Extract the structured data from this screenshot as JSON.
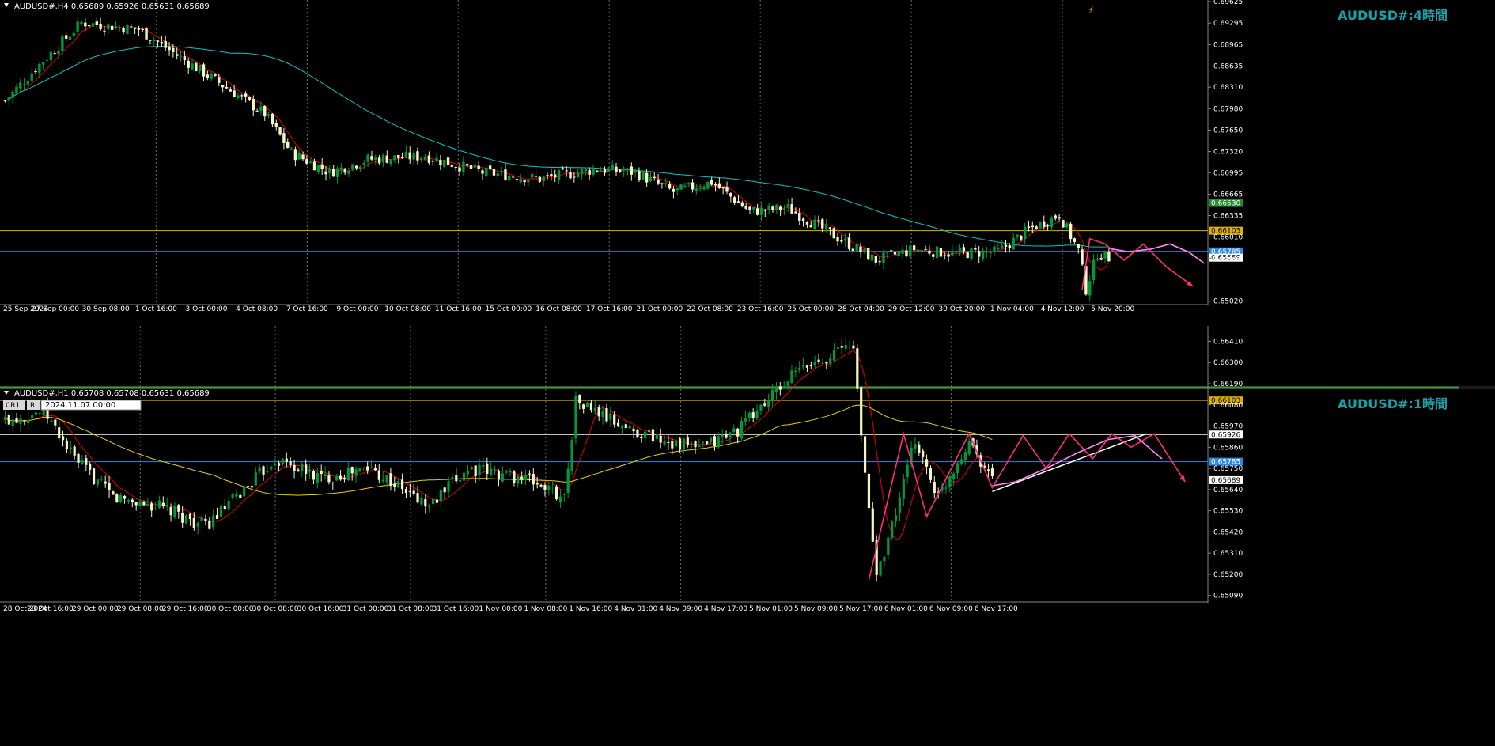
{
  "chart_data": [
    {
      "type": "candlestick",
      "symbol_info": "AUDUSD#,H4  0.65689 0.65926 0.65631 0.65689",
      "title": "AUDUSD#:4時間",
      "colors": {
        "title": "#17a2a8",
        "bull": "#009a3b",
        "bear": "#f5f5c8",
        "ma_fast": "#e00000",
        "ma_slow": "#00c8c8",
        "forecast_light": "#ff88ee",
        "forecast_dark": "#ff2f78"
      },
      "y_ticks": [
        "0.69625",
        "0.69295",
        "0.68965",
        "0.68635",
        "0.68310",
        "0.67980",
        "0.67650",
        "0.67320",
        "0.66995",
        "0.66665",
        "0.66335",
        "0.66010",
        "0.65680",
        "0.65020"
      ],
      "ylim": [
        0.6498,
        0.6965
      ],
      "x_ticks": [
        "25 Sep 2024",
        "27 Sep 00:00",
        "30 Sep 08:00",
        "1 Oct 16:00",
        "3 Oct 00:00",
        "4 Oct 08:00",
        "7 Oct 16:00",
        "9 Oct 00:00",
        "10 Oct 08:00",
        "11 Oct 16:00",
        "15 Oct 00:00",
        "16 Oct 08:00",
        "17 Oct 16:00",
        "21 Oct 00:00",
        "22 Oct 08:00",
        "23 Oct 16:00",
        "25 Oct 00:00",
        "28 Oct 04:00",
        "29 Oct 12:00",
        "30 Oct 20:00",
        "1 Nov 04:00",
        "4 Nov 12:00",
        "5 Nov 20:00"
      ],
      "anchors": [
        [
          0,
          0.681
        ],
        [
          8,
          0.686
        ],
        [
          20,
          0.693
        ],
        [
          35,
          0.692
        ],
        [
          45,
          0.688
        ],
        [
          58,
          0.683
        ],
        [
          68,
          0.679
        ],
        [
          75,
          0.673
        ],
        [
          85,
          0.67
        ],
        [
          95,
          0.672
        ],
        [
          110,
          0.6725
        ],
        [
          125,
          0.67
        ],
        [
          140,
          0.669
        ],
        [
          155,
          0.6705
        ],
        [
          165,
          0.67
        ],
        [
          175,
          0.667
        ],
        [
          185,
          0.6685
        ],
        [
          195,
          0.664
        ],
        [
          205,
          0.6645
        ],
        [
          215,
          0.661
        ],
        [
          228,
          0.6565
        ],
        [
          238,
          0.6582
        ],
        [
          248,
          0.6575
        ],
        [
          260,
          0.6578
        ],
        [
          268,
          0.6612
        ],
        [
          276,
          0.6635
        ],
        [
          281,
          0.658
        ],
        [
          283,
          0.652
        ],
        [
          286,
          0.6575
        ],
        [
          289,
          0.6569
        ]
      ],
      "levels": [
        {
          "value": 0.6653,
          "label": "0.66530",
          "color": "#1f8f2f",
          "text_color": "#fff"
        },
        {
          "value": 0.66103,
          "label": "0.66103",
          "color": "#e0b000",
          "text_color": "#000"
        },
        {
          "value": 0.65785,
          "label": "0.65785",
          "color": "#2d87e6",
          "text_color": "#fff"
        },
        {
          "value": 0.65689,
          "label": "0.65689",
          "color": "#ffffff",
          "text_color": "#000"
        }
      ],
      "forecast_light": [
        [
          289,
          0.6583
        ],
        [
          294,
          0.6578
        ],
        [
          300,
          0.6582
        ],
        [
          305,
          0.659
        ],
        [
          310,
          0.6577
        ],
        [
          314,
          0.656
        ]
      ],
      "forecast_dark": [
        [
          282,
          0.652
        ],
        [
          284,
          0.6598
        ],
        [
          288,
          0.659
        ],
        [
          293,
          0.6565
        ],
        [
          298,
          0.659
        ],
        [
          304,
          0.6555
        ],
        [
          311,
          0.6525
        ]
      ]
    },
    {
      "type": "candlestick",
      "symbol_info": "AUDUSD#,H1  0.65708 0.65708 0.65631 0.65689",
      "title": "AUDUSD#:1時間",
      "toolbar": {
        "cr": "CR1",
        "r": "R",
        "date_box": "2024.11.07 00:00"
      },
      "y_ticks": [
        "0.66410",
        "0.66300",
        "0.66190",
        "0.66080",
        "0.65970",
        "0.65860",
        "0.65750",
        "0.65640",
        "0.65530",
        "0.65420",
        "0.65310",
        "0.65200",
        "0.65090"
      ],
      "ylim": [
        0.6506,
        0.6649
      ],
      "x_ticks": [
        "28 Oct 2024",
        "28 Oct 16:00",
        "29 Oct 00:00",
        "29 Oct 08:00",
        "29 Oct 16:00",
        "30 Oct 00:00",
        "30 Oct 08:00",
        "30 Oct 16:00",
        "31 Oct 00:00",
        "31 Oct 08:00",
        "31 Oct 16:00",
        "1 Nov 00:00",
        "1 Nov 08:00",
        "1 Nov 16:00",
        "4 Nov 01:00",
        "4 Nov 09:00",
        "4 Nov 17:00",
        "5 Nov 01:00",
        "5 Nov 09:00",
        "5 Nov 17:00",
        "6 Nov 01:00",
        "6 Nov 09:00",
        "6 Nov 17:00"
      ],
      "anchors": [
        [
          0,
          0.66
        ],
        [
          10,
          0.6605
        ],
        [
          18,
          0.658
        ],
        [
          28,
          0.656
        ],
        [
          40,
          0.6555
        ],
        [
          52,
          0.6545
        ],
        [
          60,
          0.656
        ],
        [
          70,
          0.658
        ],
        [
          82,
          0.657
        ],
        [
          95,
          0.6575
        ],
        [
          110,
          0.6555
        ],
        [
          120,
          0.6575
        ],
        [
          135,
          0.657
        ],
        [
          145,
          0.656
        ],
        [
          148,
          0.661
        ],
        [
          162,
          0.6595
        ],
        [
          180,
          0.6585
        ],
        [
          190,
          0.6595
        ],
        [
          205,
          0.6625
        ],
        [
          215,
          0.6635
        ],
        [
          220,
          0.664
        ],
        [
          222,
          0.659
        ],
        [
          226,
          0.652
        ],
        [
          230,
          0.6545
        ],
        [
          236,
          0.659
        ],
        [
          242,
          0.656
        ],
        [
          250,
          0.659
        ],
        [
          256,
          0.6569
        ]
      ],
      "levels": [
        {
          "value": 0.66103,
          "label": "0.66103",
          "color": "#e0b000",
          "text_color": "#000"
        },
        {
          "value": 0.65926,
          "label": "0.65926",
          "color": "#ffffff",
          "text_color": "#000"
        },
        {
          "value": 0.65785,
          "label": "0.65785",
          "color": "#2d87e6",
          "text_color": "#fff"
        },
        {
          "value": 0.65689,
          "label": "0.65689",
          "color": "#ffffff",
          "text_color": "#000"
        }
      ],
      "trendline": [
        [
          256,
          0.6563
        ],
        [
          296,
          0.6593
        ]
      ],
      "forecast_light": [
        [
          256,
          0.6566
        ],
        [
          262,
          0.6568
        ],
        [
          270,
          0.6575
        ],
        [
          278,
          0.6583
        ],
        [
          286,
          0.659
        ],
        [
          293,
          0.6592
        ],
        [
          300,
          0.658
        ]
      ],
      "forecast_dark": [
        [
          224,
          0.6517
        ],
        [
          233,
          0.6593
        ],
        [
          239,
          0.655
        ],
        [
          250,
          0.6593
        ],
        [
          256,
          0.6565
        ],
        [
          264,
          0.6592
        ],
        [
          270,
          0.6575
        ],
        [
          276,
          0.6593
        ],
        [
          282,
          0.658
        ],
        [
          287,
          0.6593
        ],
        [
          292,
          0.6586
        ],
        [
          298,
          0.6593
        ],
        [
          306,
          0.6568
        ]
      ]
    }
  ]
}
